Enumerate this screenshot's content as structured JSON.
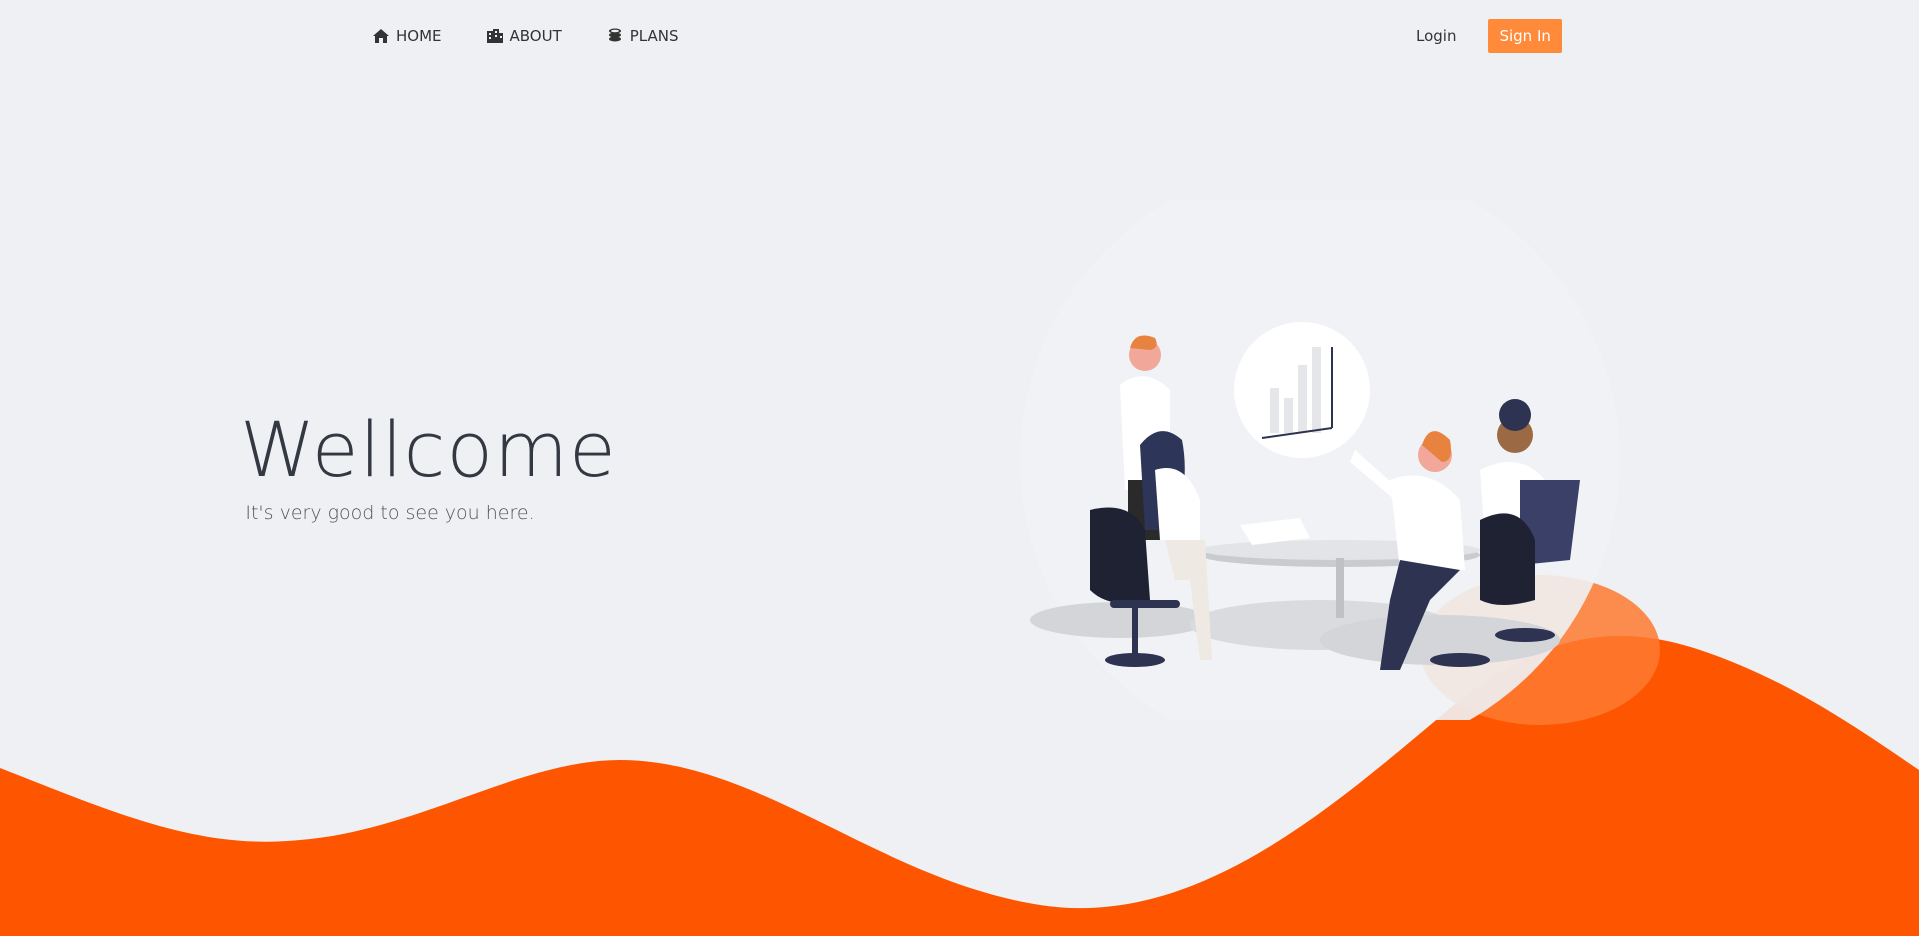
{
  "nav": {
    "items": [
      {
        "label": "HOME",
        "icon": "home-icon"
      },
      {
        "label": "ABOUT",
        "icon": "building-icon"
      },
      {
        "label": "PLANS",
        "icon": "coins-icon"
      }
    ],
    "login_label": "Login",
    "signin_label": "Sign In"
  },
  "hero": {
    "title": "Wellcome",
    "subtitle": "It's very good to see you here."
  },
  "colors": {
    "accent": "#fe5500",
    "button": "#fe8a3a",
    "background": "#eef0f3"
  }
}
